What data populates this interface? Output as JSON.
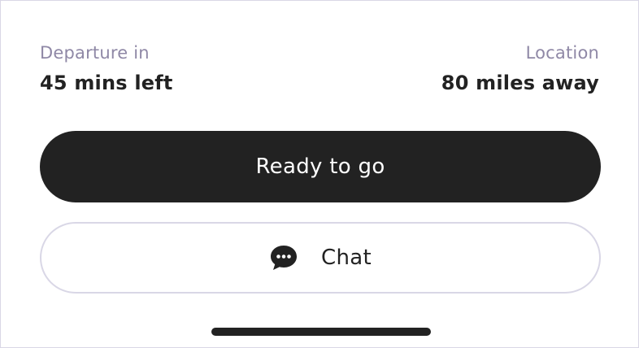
{
  "departure": {
    "label": "Departure in",
    "value": "45 mins left"
  },
  "location": {
    "label": "Location",
    "value": "80 miles away"
  },
  "actions": {
    "primary_label": "Ready to go",
    "chat_label": "Chat",
    "chat_icon": "chat-bubble-icon"
  },
  "colors": {
    "primary_button": "#222222",
    "label_text": "#8f88a6",
    "border": "#d9d7e6"
  }
}
